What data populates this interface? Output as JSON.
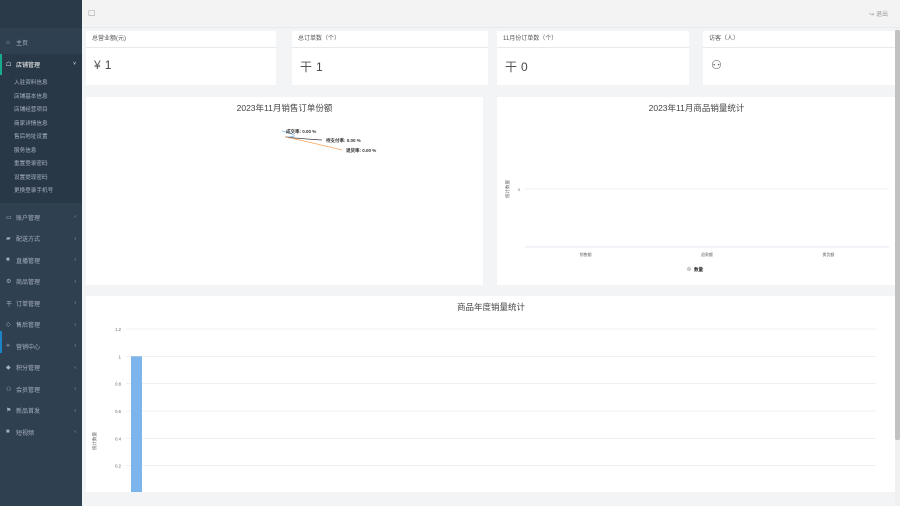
{
  "sidebar": {
    "items": [
      {
        "icon": "home-icon",
        "glyph": "⌂",
        "label": "主页",
        "active": false,
        "arrow": ""
      },
      {
        "icon": "bank-icon",
        "glyph": "☖",
        "label": "店铺管理",
        "active": true,
        "arrow": "˅"
      }
    ],
    "submenu": [
      "入驻资料信息",
      "店铺基本信息",
      "店铺经营项目",
      "商家详情信息",
      "售后地址设置",
      "服务信息",
      "重置登录密码",
      "设置提现密码",
      "更换登录手机号"
    ],
    "items2": [
      {
        "icon": "credit-card-icon",
        "glyph": "▭",
        "label": "账户管理",
        "arrow": "‹"
      },
      {
        "icon": "truck-icon",
        "glyph": "▰",
        "label": "配送方式",
        "arrow": "‹"
      },
      {
        "icon": "video-icon",
        "glyph": "■",
        "label": "直播管理",
        "arrow": "‹"
      },
      {
        "icon": "gear-icon",
        "glyph": "⚙",
        "label": "商品管理",
        "arrow": "‹"
      },
      {
        "icon": "order-icon",
        "glyph": "干",
        "label": "订单管理",
        "arrow": "‹"
      },
      {
        "icon": "diamond-icon",
        "glyph": "◇",
        "label": "售后管理",
        "arrow": "‹"
      },
      {
        "icon": "marketing-icon",
        "glyph": "⟡",
        "label": "营销中心",
        "arrow": "‹"
      },
      {
        "icon": "points-icon",
        "glyph": "◆",
        "label": "积分管理",
        "arrow": "‹"
      },
      {
        "icon": "users-icon",
        "glyph": "⚇",
        "label": "会员管理",
        "arrow": "‹"
      },
      {
        "icon": "flag-icon",
        "glyph": "⚑",
        "label": "新品首发",
        "arrow": "‹"
      },
      {
        "icon": "video-camera-icon",
        "glyph": "■",
        "label": "短视频",
        "arrow": "‹"
      }
    ]
  },
  "topbar": {
    "monitor_glyph": "▢",
    "logout_label": "↪ 退出"
  },
  "cards": [
    {
      "title": "总营业额(元)",
      "icon_glyph": "¥",
      "icon": "yen-icon",
      "value": "1"
    },
    {
      "title": "总订单数（个）",
      "icon_glyph": "干",
      "icon": "order-icon",
      "value": "1"
    },
    {
      "title": "11月份订单数（个）",
      "icon_glyph": "干",
      "icon": "order-icon",
      "value": "0"
    },
    {
      "title": "访客（人）",
      "icon_glyph": "⚇",
      "icon": "users-icon",
      "value": ""
    }
  ],
  "chart_data": [
    {
      "type": "pie",
      "title": "2023年11月销售订单份额",
      "slices": [
        {
          "name": "成交率",
          "value": 0,
          "label": "成交率: 0.00 %"
        },
        {
          "name": "待支付率",
          "value": 0,
          "label": "待支付率: 0.00 %"
        },
        {
          "name": "退货率",
          "value": 0,
          "label": "退货率: 0.00 %"
        }
      ]
    },
    {
      "type": "bar",
      "title": "2023年11月商品销量统计",
      "ylabel": "统计数量",
      "categories": [
        "销售额",
        "退款额",
        "换货额"
      ],
      "series": [
        {
          "name": "数量",
          "values": [
            0,
            0,
            0
          ]
        }
      ],
      "yticks": [
        "0"
      ],
      "legend": "bottom"
    },
    {
      "type": "bar",
      "title": "商品年度销量统计",
      "ylabel": "统计数量",
      "yticks": [
        "1.2",
        "1",
        "0.8",
        "0.6",
        "0.4",
        "0.2"
      ],
      "ylim": [
        0,
        1.2
      ],
      "values": [
        1
      ],
      "color": "#7cb5ec"
    }
  ]
}
